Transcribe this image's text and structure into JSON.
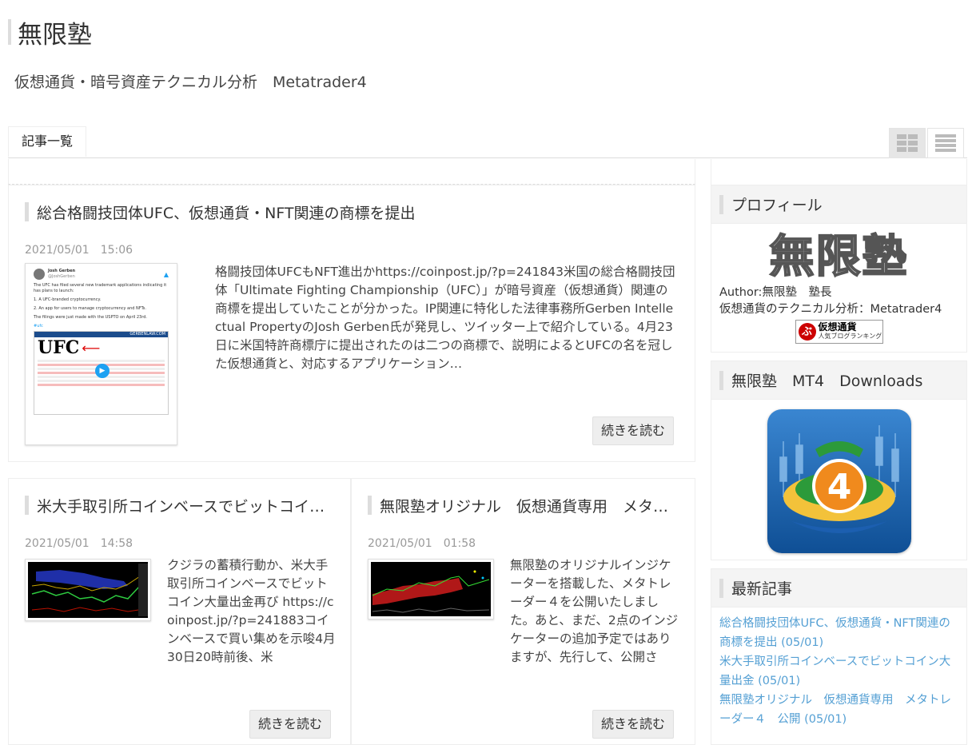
{
  "site": {
    "title": "無限塾",
    "description": "仮想通貨・暗号資産テクニカル分析　Metatrader4"
  },
  "nav": {
    "tab_label": "記事一覧"
  },
  "articles": [
    {
      "title": "総合格闘技団体UFC、仮想通貨・NFT関連の商標を提出",
      "date": "2021/05/01　15:06",
      "excerpt": "格闘技団体UFCもNFT進出かhttps://coinpost.jp/?p=241843米国の総合格闘技団体「Ultimate Fighting Championship（UFC）」が暗号資産（仮想通貨）関連の商標を提出していたことが分かった。IP関連に特化した法律事務所Gerben Intellectual PropertyのJosh Gerben氏が発見し、ツイッター上で紹介している。4月23日に米国特許商標庁に提出されたのは二つの商標で、説明によるとUFCの名を冠した仮想通貨と、対応するアプリケーション…",
      "more": "続きを読む",
      "tweet": {
        "author": "Josh Gerben",
        "handle": "@JoshGerben",
        "text1": "The UFC has filed several new trademark applications indicating it has plans to launch:",
        "text2": "1. A UFC-branded cryptocurrency.",
        "text3": "2. An app for users to manage cryptocurrency and NFTs.",
        "text4": "The filings were just made with the USPTO on April 23rd.",
        "tag": "#ufc",
        "law": "GERBENLAW.COM",
        "logo": "UFC"
      }
    },
    {
      "title": "米大手取引所コインベースでビットコイン大量出金",
      "date": "2021/05/01　14:58",
      "excerpt": "クジラの蓄積行動か、米大手取引所コインベースでビットコイン大量出金再び https://coinpost.jp/?p=241883コインベースで買い集めを示唆4月30日20時前後、米",
      "more": "続きを読む"
    },
    {
      "title": "無限塾オリジナル　仮想通貨専用　メタトレーダー４　公開",
      "date": "2021/05/01　01:58",
      "excerpt": "無限塾のオリジナルインジケーターを搭載した、メタトレーダー４を公開いたしました。あと、まだ、2点のインジケーターの追加予定ではありますが、先行して、公開さ",
      "more": "続きを読む"
    }
  ],
  "sidebar": {
    "profile": {
      "heading": "プロフィール",
      "logo_text": "無限塾",
      "author": "Author:無限塾　塾長",
      "bio": "仮想通貨のテクニカル分析：Metatrader4",
      "banner_main": "仮想通貨",
      "banner_sub": "人気ブログランキング"
    },
    "downloads": {
      "heading": "無限塾　MT4　Downloads",
      "badge": "4"
    },
    "recent": {
      "heading": "最新記事",
      "items": [
        "総合格闘技団体UFC、仮想通貨・NFT関連の商標を提出 (05/01)",
        "米大手取引所コインベースでビットコイン大量出金 (05/01)",
        "無限塾オリジナル　仮想通貨専用　メタトレーダー４　公開 (05/01)"
      ]
    }
  },
  "colors": {
    "link": "#55a0d4",
    "accent_bar": "#dddddd"
  }
}
